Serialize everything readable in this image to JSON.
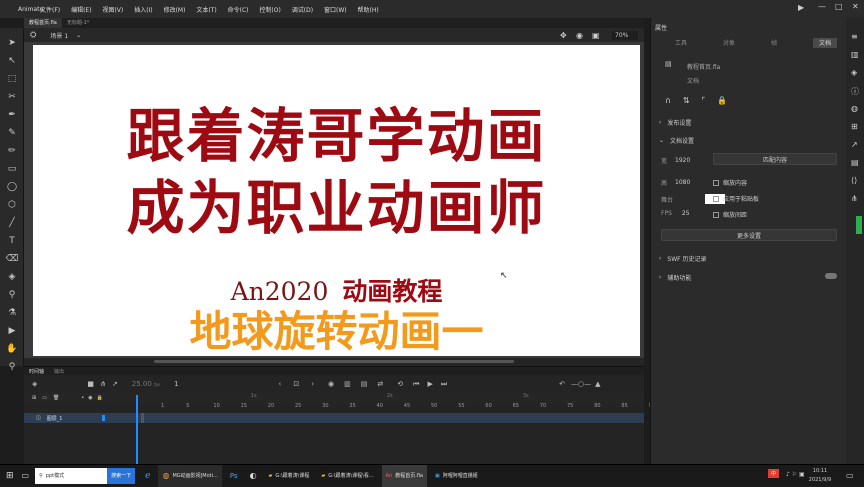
{
  "titlebar": {
    "app_name": "Animate",
    "menu": [
      "文件(F)",
      "编辑(E)",
      "视图(V)",
      "插入(I)",
      "修改(M)",
      "文本(T)",
      "命令(C)",
      "控制(O)",
      "调试(D)",
      "窗口(W)",
      "帮助(H)"
    ]
  },
  "doc_tabs": [
    {
      "label": "教程首页.fla"
    },
    {
      "label": "无标题-1*"
    }
  ],
  "editbar": {
    "scene": "场景 1",
    "zoom": "70%"
  },
  "stage": {
    "line1": "跟着涛哥学动画",
    "line2": "成为职业动画师",
    "line3_latin": "An2020",
    "line3_cn": "动画教程",
    "line4": "地球旋转动画一"
  },
  "timeline": {
    "tabs": [
      "时间轴",
      "输出"
    ],
    "fps": "25.00",
    "fps_unit": "fps",
    "frame": "1",
    "layer_name": "图层_1",
    "frame_numbers": [
      "1",
      "5",
      "10",
      "15",
      "20",
      "25",
      "30",
      "35",
      "40",
      "45",
      "50",
      "55",
      "60",
      "65",
      "70",
      "75",
      "80",
      "85",
      "90"
    ],
    "second_marks": [
      "1s",
      "2s",
      "3s"
    ]
  },
  "properties": {
    "header": "属性",
    "tabs": [
      "工具",
      "对象",
      "帧",
      "文档"
    ],
    "doc_name": "教程首页.fla",
    "doc_label": "文档",
    "publish_settings": "发布设置",
    "doc_settings": "文档设置",
    "width_label": "宽",
    "width_value": "1920",
    "height_label": "高",
    "height_value": "1080",
    "stage_label": "舞台",
    "fps_label": "FPS",
    "fps_value": "25",
    "match_contents": "匹配内容",
    "scale_content": "缩放内容",
    "apply_pasteboard": "应用于粘贴板",
    "scale_spacing": "缩放间距",
    "more_settings": "更多设置",
    "swf_history": "SWF 历史记录",
    "accessibility": "辅助功能"
  },
  "taskbar": {
    "search_text": "ppt模式",
    "search_button": "搜索一下",
    "apps": [
      "MG动画影视|Moti...",
      "G:\\跟着涛\\课程",
      "G:\\跟着涛\\课程\\看...",
      "教程首页.fla",
      "阿哩阿哩直播姬"
    ],
    "time": "10:11",
    "date": "2021/9/9",
    "ime": "中"
  },
  "colors": {
    "title_red": "#9e0a12",
    "subtitle_orange": "#f39a1c",
    "playhead_blue": "#1e8dff"
  }
}
